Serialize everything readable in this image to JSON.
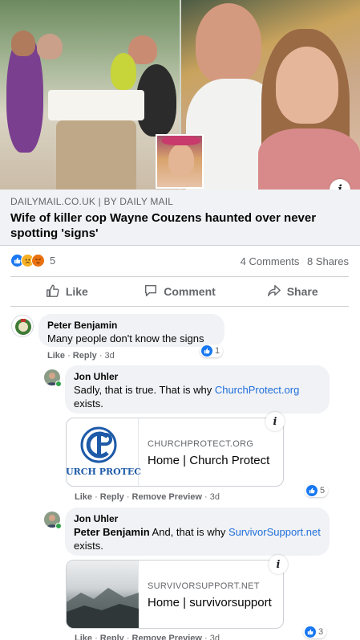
{
  "post": {
    "link_domain": "DAILYMAIL.CO.UK | BY DAILY MAIL",
    "link_title": "Wife of killer cop Wayne Couzens haunted over never spotting 'signs'",
    "reaction_count": "5",
    "comments_count": "4 Comments",
    "shares_count": "8 Shares"
  },
  "actions": {
    "like": "Like",
    "comment": "Comment",
    "share": "Share"
  },
  "comments": [
    {
      "author": "Peter Benjamin",
      "text": "Many people don't know the signs",
      "like": "Like",
      "reply": "Reply",
      "time": "3d",
      "reactions": "1"
    }
  ],
  "replies": [
    {
      "author": "Jon Uhler",
      "text_before": "Sadly, that is true. That is why ",
      "link": "ChurchProtect.org",
      "text_after": " exists.",
      "preview_domain": "CHURCHPROTECT.ORG",
      "preview_title": "Home | Church Protect",
      "preview_image_text": "URCH PROTEC",
      "like": "Like",
      "reply": "Reply",
      "remove": "Remove Preview",
      "time": "3d",
      "reactions": "5"
    },
    {
      "author": "Jon Uhler",
      "mention": "Peter Benjamin",
      "text_before": " And, that is why ",
      "link": "SurvivorSupport.net",
      "text_after": " exists.",
      "preview_domain": "SURVIVORSUPPORT.NET",
      "preview_title": "Home | survivorsupport",
      "like": "Like",
      "reply": "Reply",
      "remove": "Remove Preview",
      "time": "3d",
      "reactions": "3"
    }
  ],
  "colors": {
    "facebook_blue": "#1877f2",
    "link_blue": "#216fdb",
    "bubble_gray": "#f0f2f5",
    "secondary_text": "#65676b"
  },
  "icons": [
    "info-icon",
    "like-reaction-icon",
    "sad-reaction-icon",
    "angry-reaction-icon",
    "thumbs-up-icon",
    "comment-icon",
    "share-icon"
  ]
}
